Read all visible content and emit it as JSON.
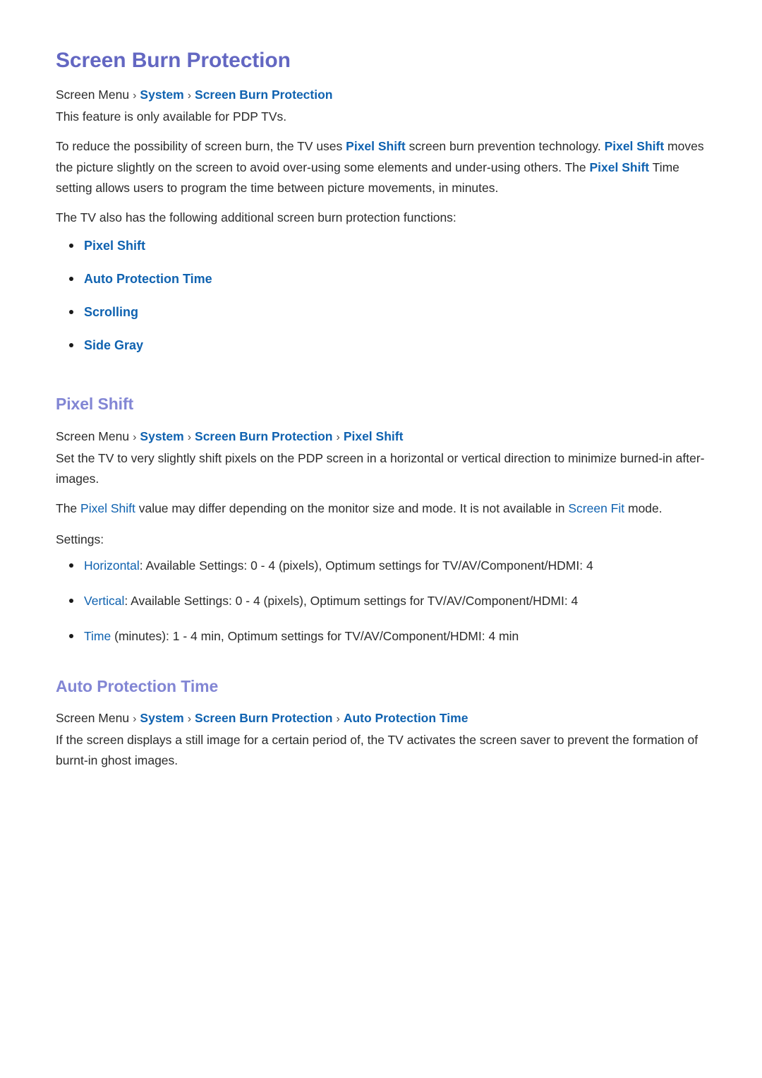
{
  "document": {
    "title": "Screen Burn Protection"
  },
  "intro": {
    "breadcrumb": {
      "root": "Screen Menu",
      "sep": "›",
      "items": [
        "System",
        "Screen Burn Protection"
      ]
    },
    "availability": "This feature is only available for PDP TVs.",
    "paragraph_1": {
      "part_1": "To reduce the possibility of screen burn, the TV uses ",
      "link_1": "Pixel Shift",
      "part_2": " screen burn prevention technology. ",
      "link_2": "Pixel Shift",
      "part_3": " moves the picture slightly on the screen to avoid over-using some elements and under-using others. The ",
      "link_3": "Pixel Shift",
      "part_4": " Time setting allows users to program the time between picture movements, in minutes."
    },
    "functions_intro": "The TV also has the following additional screen burn protection functions:",
    "functions": [
      "Pixel Shift",
      "Auto Protection Time",
      "Scrolling",
      "Side Gray"
    ]
  },
  "pixel_shift": {
    "heading": "Pixel Shift",
    "breadcrumb": {
      "root": "Screen Menu",
      "sep": "›",
      "items": [
        "System",
        "Screen Burn Protection",
        "Pixel Shift"
      ]
    },
    "paragraph_1": "Set the TV to very slightly shift pixels on the PDP screen in a horizontal or vertical direction to minimize burned-in after-images.",
    "paragraph_2": {
      "part_1": "The ",
      "link_1": "Pixel Shift",
      "part_2": " value may differ depending on the monitor size and mode. It is not available in ",
      "link_2": "Screen Fit",
      "part_3": " mode."
    },
    "settings_heading": "Settings:",
    "settings": [
      {
        "label": "Horizontal",
        "text": ": Available Settings: 0 - 4 (pixels), Optimum settings for TV/AV/Component/HDMI: 4"
      },
      {
        "label": "Vertical",
        "text": ": Available Settings: 0 - 4 (pixels), Optimum settings for TV/AV/Component/HDMI: 4"
      },
      {
        "label": "Time",
        "text": " (minutes): 1 - 4 min, Optimum settings for TV/AV/Component/HDMI: 4 min"
      }
    ]
  },
  "auto_protection_time": {
    "heading": "Auto Protection Time",
    "breadcrumb": {
      "root": "Screen Menu",
      "sep": "›",
      "items": [
        "System",
        "Screen Burn Protection",
        "Auto Protection Time"
      ]
    },
    "paragraph_1": "If the screen displays a still image for a certain period of, the TV activates the screen saver to prevent the formation of burnt-in ghost images."
  },
  "colors": {
    "title": "#6367c2",
    "section_heading": "#8286d4",
    "link": "#0f62b0",
    "body": "#2b2b2b",
    "background": "#ffffff"
  }
}
